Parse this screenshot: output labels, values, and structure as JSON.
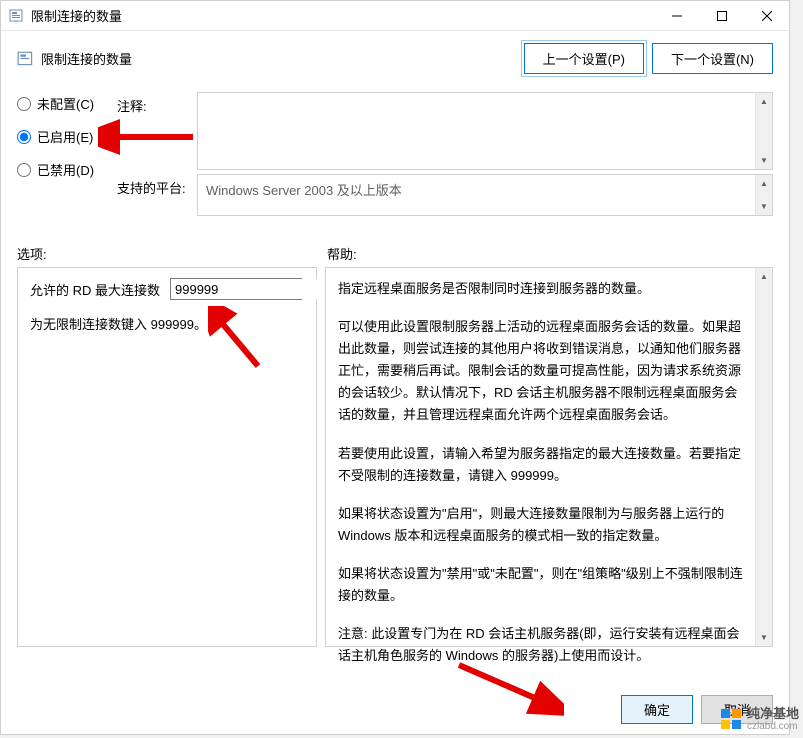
{
  "titlebar": {
    "title": "限制连接的数量"
  },
  "header": {
    "title": "限制连接的数量",
    "prev_btn": "上一个设置(P)",
    "next_btn": "下一个设置(N)"
  },
  "radios": {
    "not_configured": "未配置(C)",
    "enabled": "已启用(E)",
    "disabled": "已禁用(D)",
    "selected": "enabled"
  },
  "details": {
    "comment_label": "注释:",
    "comment_value": "",
    "supported_label": "支持的平台:",
    "supported_value": "Windows Server 2003 及以上版本"
  },
  "sections": {
    "options_label": "选项:",
    "help_label": "帮助:"
  },
  "options": {
    "max_conn_label": "允许的 RD 最大连接数",
    "max_conn_value": "999999",
    "hint": "为无限制连接数键入 999999。"
  },
  "help": {
    "p1": "指定远程桌面服务是否限制同时连接到服务器的数量。",
    "p2": "可以使用此设置限制服务器上活动的远程桌面服务会话的数量。如果超出此数量，则尝试连接的其他用户将收到错误消息，以通知他们服务器正忙，需要稍后再试。限制会话的数量可提高性能，因为请求系统资源的会话较少。默认情况下，RD 会话主机服务器不限制远程桌面服务会话的数量，并且管理远程桌面允许两个远程桌面服务会话。",
    "p3": "若要使用此设置，请输入希望为服务器指定的最大连接数量。若要指定不受限制的连接数量，请键入 999999。",
    "p4": "如果将状态设置为\"启用\"，则最大连接数量限制为与服务器上运行的 Windows 版本和远程桌面服务的模式相一致的指定数量。",
    "p5": "如果将状态设置为\"禁用\"或\"未配置\"，则在\"组策略\"级别上不强制限制连接的数量。",
    "p6": "注意: 此设置专门为在 RD 会话主机服务器(即，运行安装有远程桌面会话主机角色服务的 Windows 的服务器)上使用而设计。"
  },
  "footer": {
    "ok": "确定",
    "cancel": "取消"
  },
  "watermark": {
    "name": "纯净基地",
    "url": "czlabd.com"
  }
}
